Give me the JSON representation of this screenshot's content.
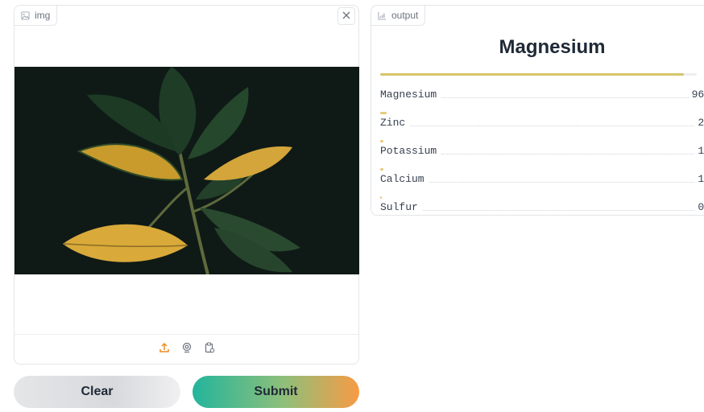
{
  "input_panel": {
    "label": "img",
    "close_icon": "close-icon",
    "toolbar": [
      "upload-icon",
      "webcam-icon",
      "clipboard-icon"
    ]
  },
  "output_panel": {
    "label": "output",
    "title": "Magnesium",
    "top_confidence": 0.96,
    "results": [
      {
        "label": "Magnesium",
        "percent": "96%",
        "value": 0.96
      },
      {
        "label": "Zinc",
        "percent": "2%",
        "value": 0.02
      },
      {
        "label": "Potassium",
        "percent": "1%",
        "value": 0.01
      },
      {
        "label": "Calcium",
        "percent": "1%",
        "value": 0.01
      },
      {
        "label": "Sulfur",
        "percent": "0%",
        "value": 0.0
      }
    ]
  },
  "buttons": {
    "clear": "Clear",
    "submit": "Submit"
  },
  "colors": {
    "accent_orange": "#f89b45",
    "accent_teal": "#23b59c",
    "bar": "#d6c469"
  }
}
